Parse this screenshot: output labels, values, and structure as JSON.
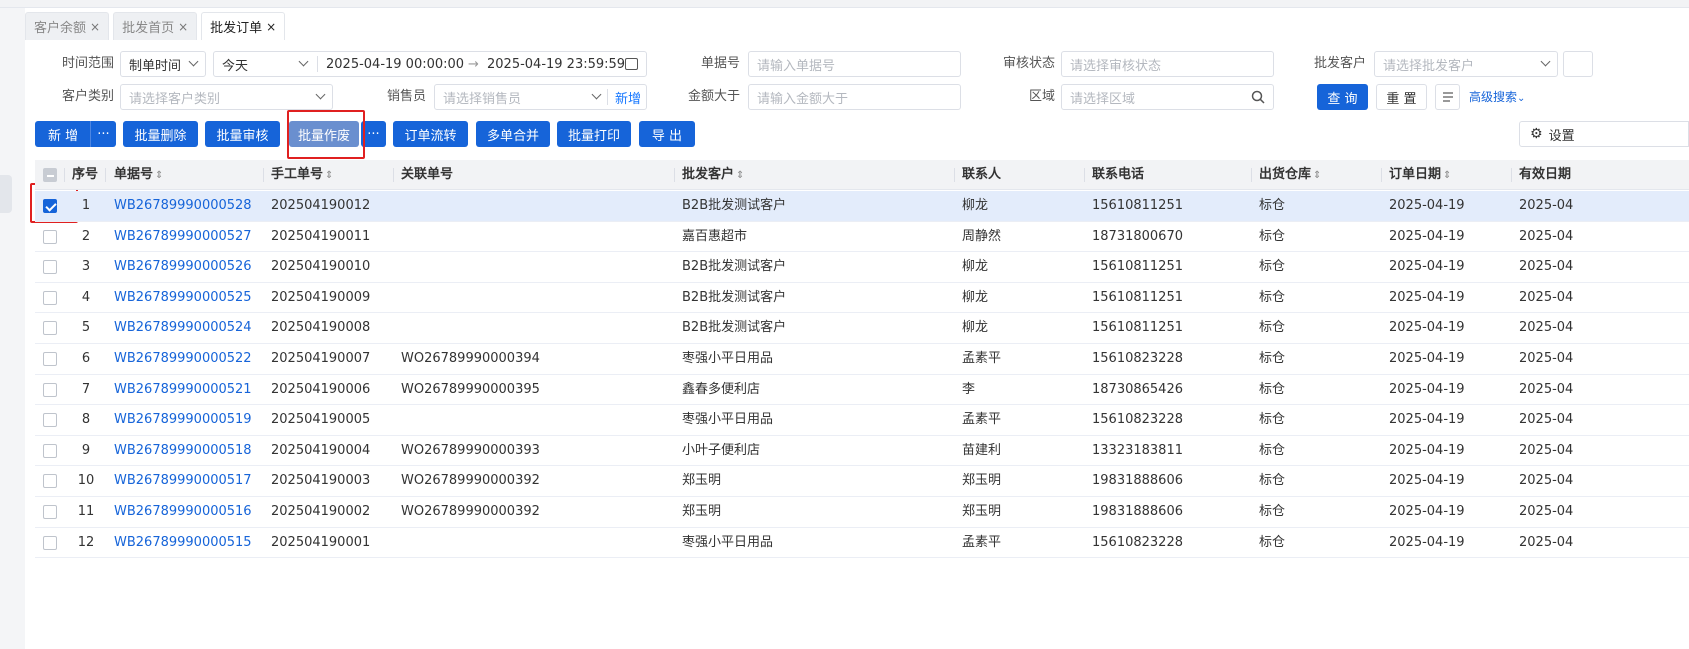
{
  "tabs": [
    {
      "label": "客户余额"
    },
    {
      "label": "批发首页"
    },
    {
      "label": "批发订单",
      "active": true
    }
  ],
  "tab_close": "×",
  "filters": {
    "time_range_label": "时间范围",
    "time_type": "制单时间",
    "time_preset": "今天",
    "start": "2025-04-19 00:00:00",
    "range_arrow": "→",
    "end": "2025-04-19 23:59:59",
    "doc_no_label": "单据号",
    "doc_no_placeholder": "请输入单据号",
    "audit_label": "审核状态",
    "audit_placeholder": "请选择审核状态",
    "customer_label": "批发客户",
    "customer_placeholder": "请选择批发客户",
    "cust_cat_label": "客户类别",
    "cust_cat_placeholder": "请选择客户类别",
    "seller_label": "销售员",
    "seller_placeholder": "请选择销售员",
    "seller_new": "新增",
    "amount_label": "金额大于",
    "amount_placeholder": "请输入金额大于",
    "area_label": "区域",
    "area_placeholder": "请选择区域",
    "query": "查 询",
    "reset": "重 置",
    "advanced": "高级搜索"
  },
  "toolbar": {
    "add": "新 增",
    "more": "···",
    "batch_delete": "批量删除",
    "batch_audit": "批量审核",
    "batch_void": "批量作废",
    "order_flow": "订单流转",
    "merge": "多单合并",
    "batch_print": "批量打印",
    "export": "导 出",
    "settings": "设置"
  },
  "columns": [
    "序号",
    "单据号",
    "手工单号",
    "关联单号",
    "批发客户",
    "联系人",
    "联系电话",
    "出货仓库",
    "订单日期",
    "有效日期"
  ],
  "rows": [
    {
      "seq": "1",
      "doc": "WB26789990000528",
      "manual": "202504190012",
      "related": "",
      "customer": "B2B批发测试客户",
      "contact": "柳龙",
      "phone": "15610811251",
      "warehouse": "标仓",
      "date": "2025-04-19",
      "valid": "2025-04",
      "checked": true
    },
    {
      "seq": "2",
      "doc": "WB26789990000527",
      "manual": "202504190011",
      "related": "",
      "customer": "嘉百惠超市",
      "contact": "周静然",
      "phone": "18731800670",
      "warehouse": "标仓",
      "date": "2025-04-19",
      "valid": "2025-04"
    },
    {
      "seq": "3",
      "doc": "WB26789990000526",
      "manual": "202504190010",
      "related": "",
      "customer": "B2B批发测试客户",
      "contact": "柳龙",
      "phone": "15610811251",
      "warehouse": "标仓",
      "date": "2025-04-19",
      "valid": "2025-04"
    },
    {
      "seq": "4",
      "doc": "WB26789990000525",
      "manual": "202504190009",
      "related": "",
      "customer": "B2B批发测试客户",
      "contact": "柳龙",
      "phone": "15610811251",
      "warehouse": "标仓",
      "date": "2025-04-19",
      "valid": "2025-04"
    },
    {
      "seq": "5",
      "doc": "WB26789990000524",
      "manual": "202504190008",
      "related": "",
      "customer": "B2B批发测试客户",
      "contact": "柳龙",
      "phone": "15610811251",
      "warehouse": "标仓",
      "date": "2025-04-19",
      "valid": "2025-04"
    },
    {
      "seq": "6",
      "doc": "WB26789990000522",
      "manual": "202504190007",
      "related": "WO26789990000394",
      "customer": "枣强小平日用品",
      "contact": "孟素平",
      "phone": "15610823228",
      "warehouse": "标仓",
      "date": "2025-04-19",
      "valid": "2025-04"
    },
    {
      "seq": "7",
      "doc": "WB26789990000521",
      "manual": "202504190006",
      "related": "WO26789990000395",
      "customer": "鑫春多便利店",
      "contact": "李",
      "phone": "18730865426",
      "warehouse": "标仓",
      "date": "2025-04-19",
      "valid": "2025-04"
    },
    {
      "seq": "8",
      "doc": "WB26789990000519",
      "manual": "202504190005",
      "related": "",
      "customer": "枣强小平日用品",
      "contact": "孟素平",
      "phone": "15610823228",
      "warehouse": "标仓",
      "date": "2025-04-19",
      "valid": "2025-04"
    },
    {
      "seq": "9",
      "doc": "WB26789990000518",
      "manual": "202504190004",
      "related": "WO26789990000393",
      "customer": "小叶子便利店",
      "contact": "苗建利",
      "phone": "13323183811",
      "warehouse": "标仓",
      "date": "2025-04-19",
      "valid": "2025-04"
    },
    {
      "seq": "10",
      "doc": "WB26789990000517",
      "manual": "202504190003",
      "related": "WO26789990000392",
      "customer": "郑玉明",
      "contact": "郑玉明",
      "phone": "19831888606",
      "warehouse": "标仓",
      "date": "2025-04-19",
      "valid": "2025-04"
    },
    {
      "seq": "11",
      "doc": "WB26789990000516",
      "manual": "202504190002",
      "related": "WO26789990000392",
      "customer": "郑玉明",
      "contact": "郑玉明",
      "phone": "19831888606",
      "warehouse": "标仓",
      "date": "2025-04-19",
      "valid": "2025-04"
    },
    {
      "seq": "12",
      "doc": "WB26789990000515",
      "manual": "202504190001",
      "related": "",
      "customer": "枣强小平日用品",
      "contact": "孟素平",
      "phone": "15610823228",
      "warehouse": "标仓",
      "date": "2025-04-19",
      "valid": "2025-04"
    }
  ],
  "colors": {
    "primary": "#1664d9",
    "highlight": "#e02020",
    "selected_row": "#e3ecfb"
  }
}
